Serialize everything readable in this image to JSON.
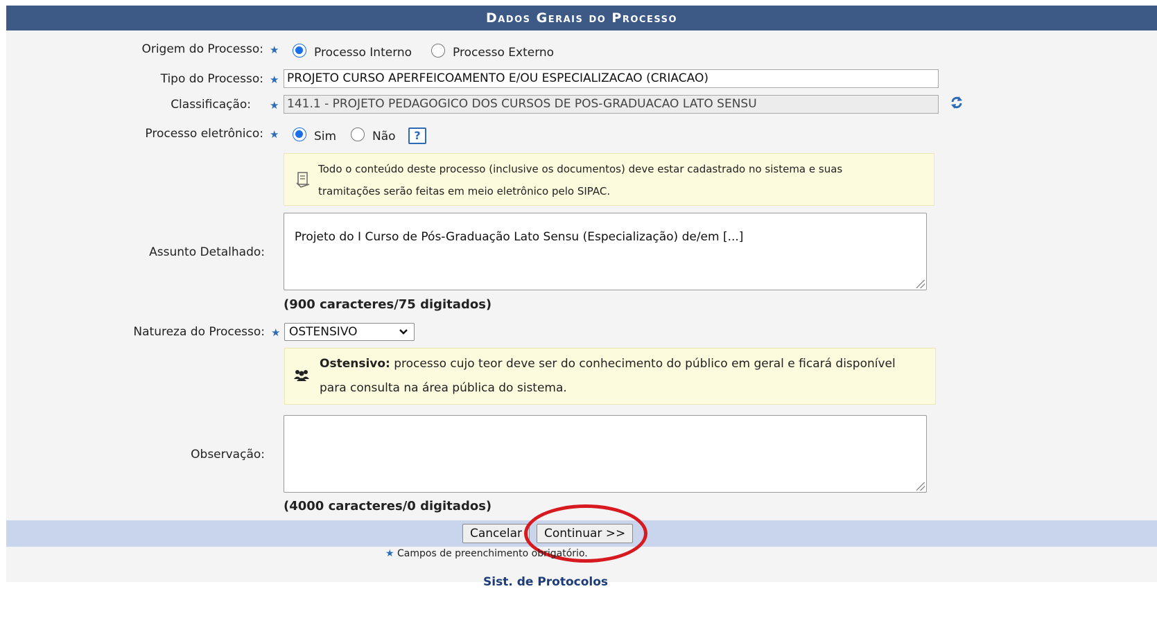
{
  "header": {
    "title": "Dados Gerais do Processo"
  },
  "origem": {
    "label": "Origem do Processo:",
    "options": [
      "Processo Interno",
      "Processo Externo"
    ],
    "selected": "Processo Interno"
  },
  "tipo": {
    "label": "Tipo do Processo:",
    "value": "PROJETO CURSO APERFEICOAMENTO E/OU ESPECIALIZACAO (CRIACAO)"
  },
  "classificacao": {
    "label": "Classificação:",
    "value": "141.1 - PROJETO PEDAGOGICO DOS CURSOS DE POS-GRADUACAO LATO SENSU"
  },
  "eletronico": {
    "label": "Processo eletrônico:",
    "options": [
      "Sim",
      "Não"
    ],
    "selected": "Sim",
    "help": "?",
    "note_line1": "Todo o conteúdo deste processo (inclusive os documentos) deve estar cadastrado no sistema e suas",
    "note_line2": "tramitações serão feitas em meio eletrônico pelo SIPAC."
  },
  "assunto": {
    "label": "Assunto Detalhado:",
    "value": "Projeto do I Curso de Pós-Graduação Lato Sensu (Especialização) de/em [...]",
    "counter": "(900 caracteres/75 digitados)"
  },
  "natureza": {
    "label": "Natureza do Processo:",
    "value": "OSTENSIVO",
    "note_bold": "Ostensivo:",
    "note_line1": " processo cujo teor deve ser do conhecimento do público em geral e ficará disponível",
    "note_line2": "para consulta na área pública do sistema."
  },
  "observacao": {
    "label": "Observação:",
    "value": "",
    "counter": "(4000 caracteres/0 digitados)"
  },
  "buttons": {
    "cancel": "Cancelar",
    "continue": "Continuar >>"
  },
  "footer": {
    "required_note": "Campos de preenchimento obrigatório.",
    "system": "Sist. de Protocolos"
  },
  "colors": {
    "header": "#3d5a87",
    "accent": "#2d6cb5",
    "highlight": "#d71920"
  }
}
